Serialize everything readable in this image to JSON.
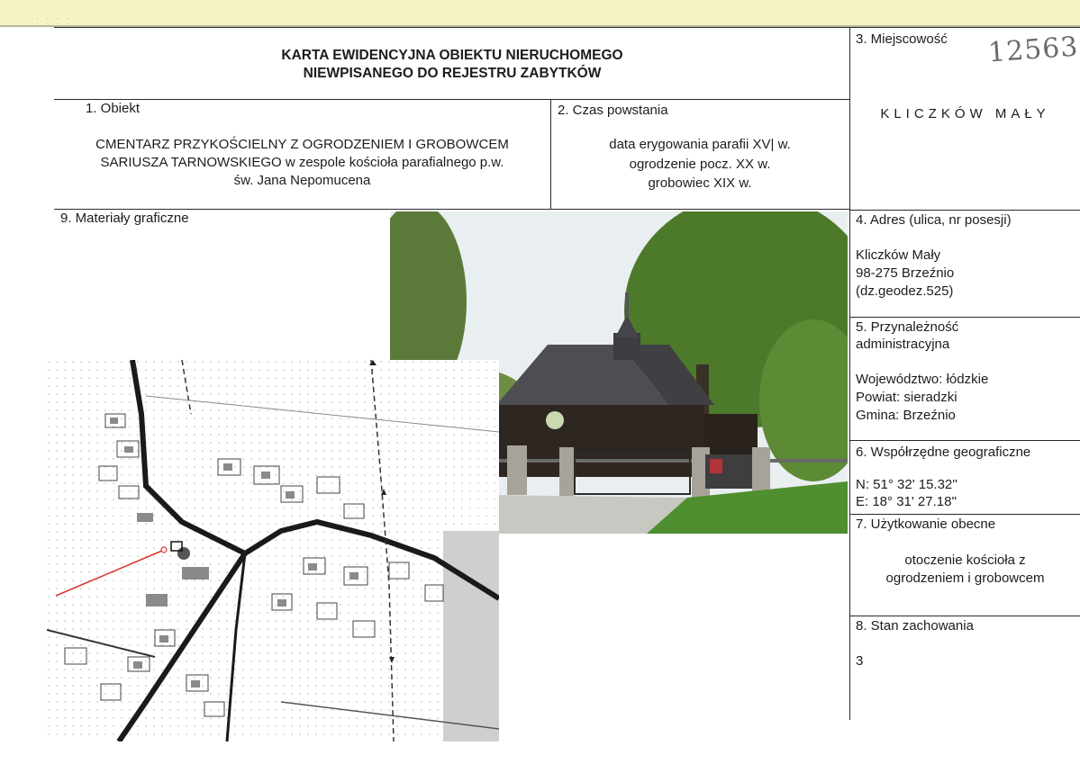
{
  "card": {
    "title_line1": "KARTA EWIDENCYJNA OBIEKTU NIERUCHOMEGO",
    "title_line2": "NIEWPISANEGO DO REJESTRU ZABYTKÓW"
  },
  "inventory_number": "12563",
  "sections": {
    "obiekt": {
      "label": "1.  Obiekt",
      "lines": [
        "CMENTARZ PRZYKOŚCIELNY Z OGRODZENIEM I GROBOWCEM",
        "SARIUSZA TARNOWSKIEGO  w zespole kościoła parafialnego p.w.",
        "św. Jana Nepomucena"
      ]
    },
    "czas": {
      "label": "2. Czas powstania",
      "lines": [
        "data erygowania parafii XV| w.",
        "ogrodzenie pocz. XX w.",
        "grobowiec XIX w."
      ]
    },
    "miejscowosc": {
      "label": "3. Miejscowość",
      "value": "KLICZKÓW MAŁY"
    },
    "adres": {
      "label": "4. Adres (ulica, nr posesji)",
      "lines": [
        "Kliczków Mały",
        "98-275 Brzeźnio",
        "(dz.geodez.525)"
      ]
    },
    "przynaleznosc": {
      "label_line1": "5. Przynależność",
      "label_line2": "administracyjna",
      "lines": [
        "Województwo: łódzkie",
        "Powiat: sieradzki",
        "Gmina: Brzeźnio"
      ]
    },
    "wspolrzedne": {
      "label": "6. Współrzędne geograficzne",
      "lines": [
        "N: 51° 32' 15.32''",
        "E: 18° 31' 27.18''"
      ]
    },
    "uzytkowanie": {
      "label": "7. Użytkowanie obecne",
      "lines": [
        "otoczenie kościoła z",
        "ogrodzeniem i grobowcem"
      ]
    },
    "stan": {
      "label": "8. Stan zachowania",
      "value": "3"
    },
    "materialy": {
      "label": "9. Materiały graficzne"
    }
  },
  "colors": {
    "scan_edge": "#f4f3c4",
    "rule": "#2a2a2a",
    "map_marker": "#d9342b"
  }
}
